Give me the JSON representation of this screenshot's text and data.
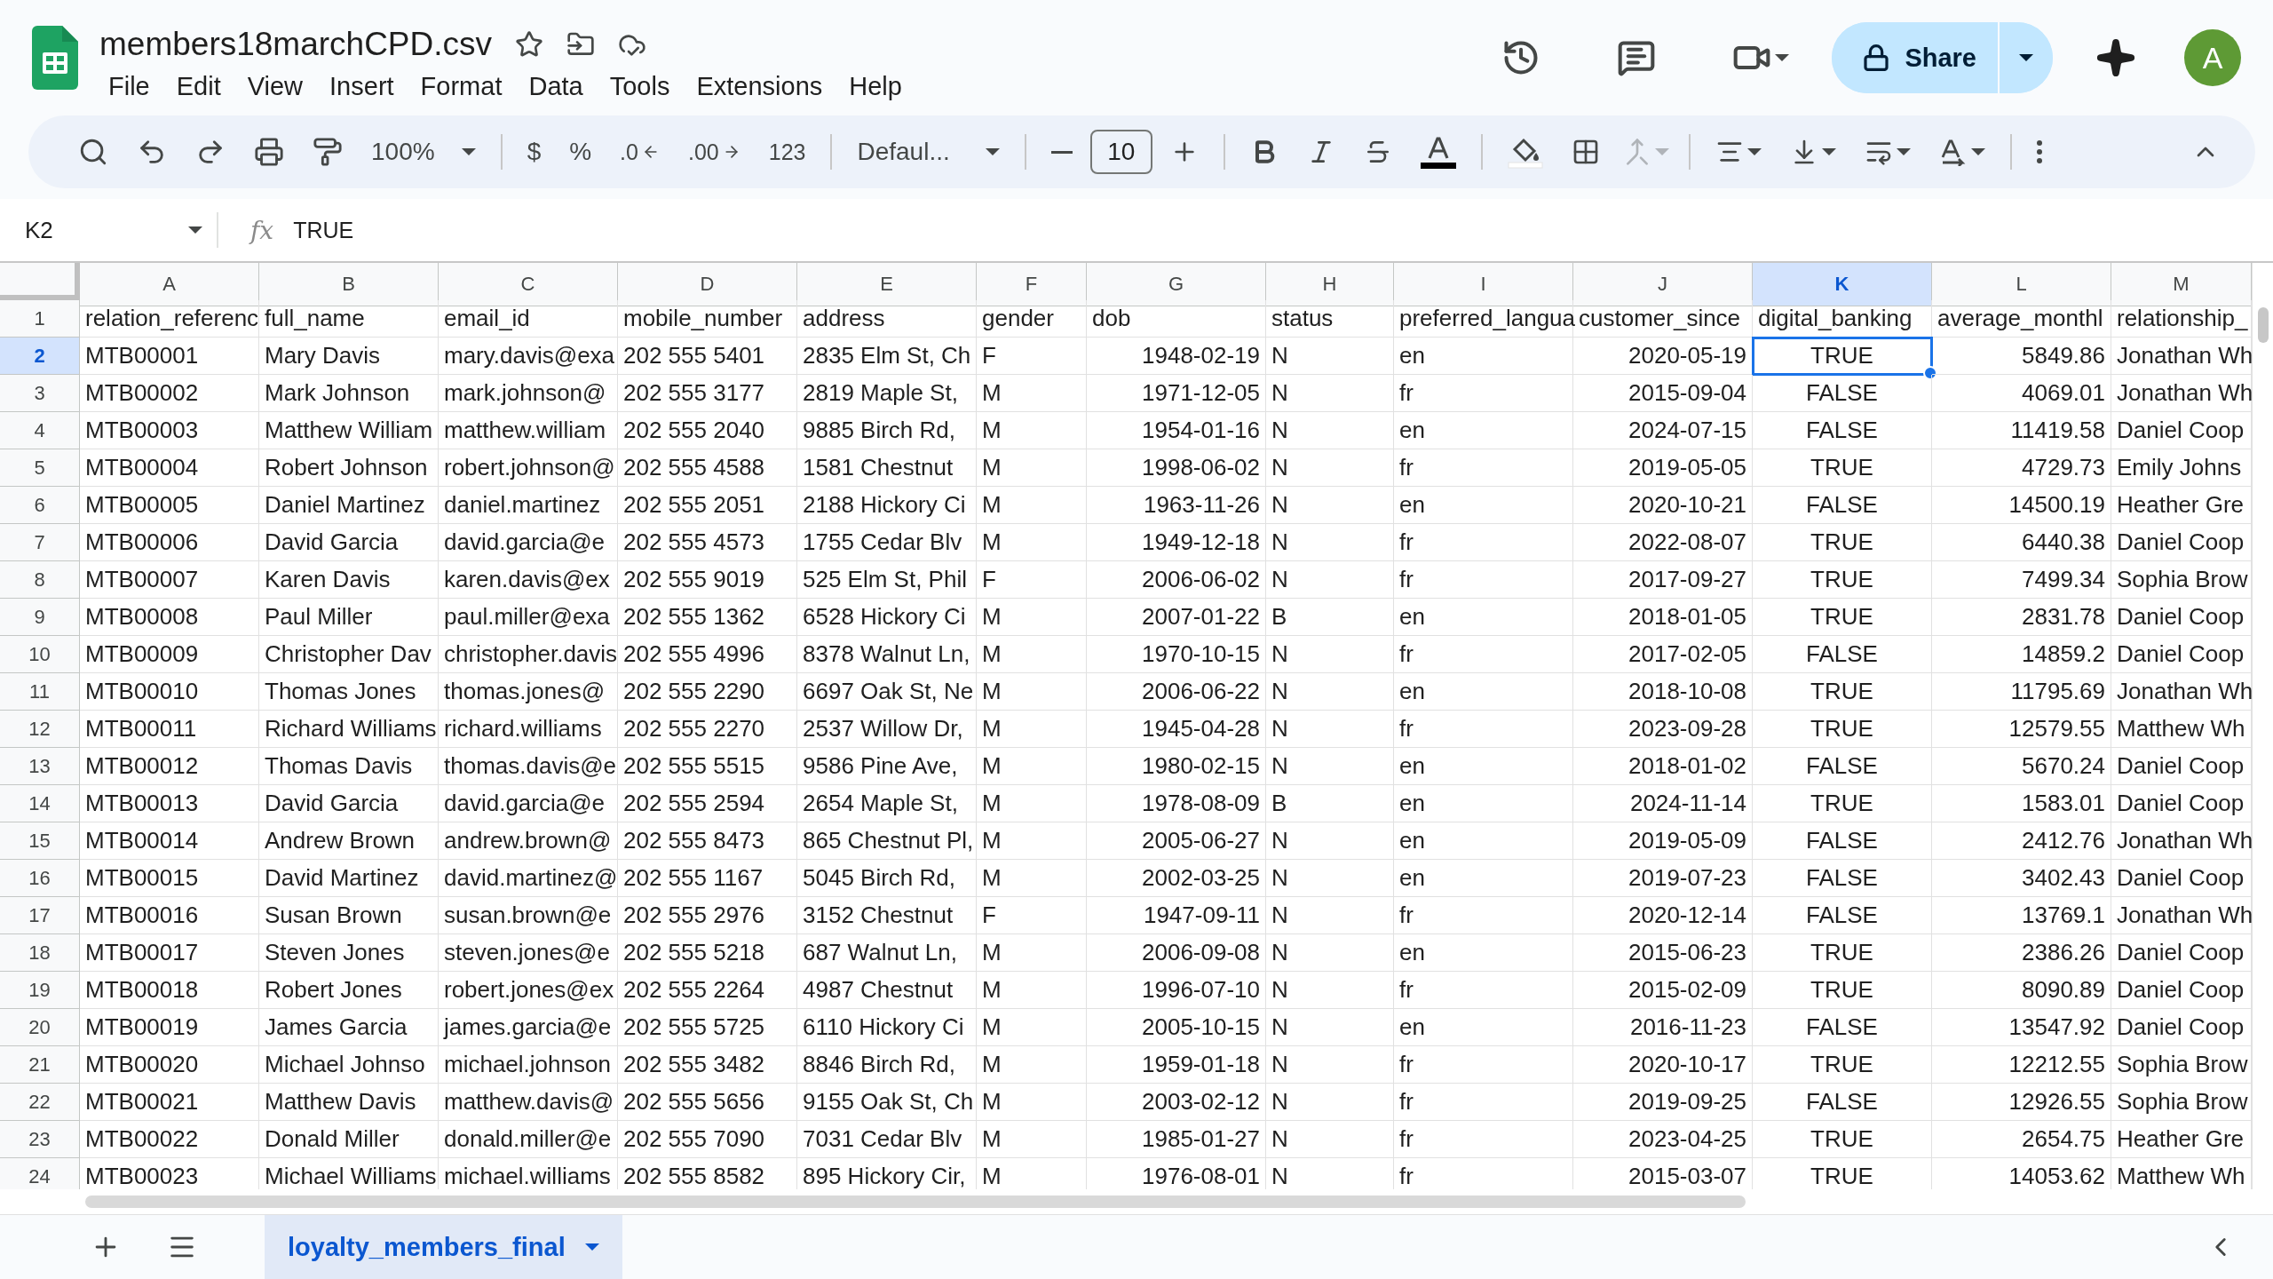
{
  "document": {
    "title": "members18marchCPD.csv"
  },
  "menu": [
    "File",
    "Edit",
    "View",
    "Insert",
    "Format",
    "Data",
    "Tools",
    "Extensions",
    "Help"
  ],
  "share": {
    "label": "Share"
  },
  "account": {
    "initial": "A"
  },
  "toolbar": {
    "zoom": "100%",
    "currency": "$",
    "percent": "%",
    "decimal_decrease": ".0",
    "decimal_increase": ".00",
    "number_format": "123",
    "font": "Defaul...",
    "font_size": "10"
  },
  "formula_bar": {
    "cell": "K2",
    "fx": "fx",
    "value": "TRUE"
  },
  "columns": [
    {
      "letter": "A",
      "kind": "text",
      "selected": false
    },
    {
      "letter": "B",
      "kind": "text",
      "selected": false
    },
    {
      "letter": "C",
      "kind": "text",
      "selected": false
    },
    {
      "letter": "D",
      "kind": "text",
      "selected": false
    },
    {
      "letter": "E",
      "kind": "text",
      "selected": false
    },
    {
      "letter": "F",
      "kind": "text",
      "selected": false
    },
    {
      "letter": "G",
      "kind": "number",
      "selected": false
    },
    {
      "letter": "H",
      "kind": "text",
      "selected": false
    },
    {
      "letter": "I",
      "kind": "text",
      "selected": false
    },
    {
      "letter": "J",
      "kind": "number",
      "selected": false
    },
    {
      "letter": "K",
      "kind": "bool",
      "selected": true
    },
    {
      "letter": "L",
      "kind": "number",
      "selected": false
    },
    {
      "letter": "M",
      "kind": "text",
      "selected": false
    }
  ],
  "rows": [
    {
      "number": "1",
      "kind": "header",
      "selected": false,
      "cells": [
        "relation_referenc",
        "full_name",
        "email_id",
        "mobile_number",
        "address",
        "gender",
        "dob",
        "status",
        "preferred_langua",
        "customer_since",
        "digital_banking",
        "average_monthl",
        "relationship_"
      ]
    },
    {
      "number": "2",
      "kind": "data",
      "selected": true,
      "cells": [
        "MTB00001",
        "Mary Davis",
        "mary.davis@exa",
        "202 555 5401",
        "2835 Elm St, Ch",
        "F",
        "1948-02-19",
        "N",
        "en",
        "2020-05-19",
        "TRUE",
        "5849.86",
        "Jonathan Wh"
      ]
    },
    {
      "number": "3",
      "kind": "data",
      "selected": false,
      "cells": [
        "MTB00002",
        "Mark Johnson",
        "mark.johnson@",
        "202 555 3177",
        "2819 Maple St,",
        "M",
        "1971-12-05",
        "N",
        "fr",
        "2015-09-04",
        "FALSE",
        "4069.01",
        "Jonathan Wh"
      ]
    },
    {
      "number": "4",
      "kind": "data",
      "selected": false,
      "cells": [
        "MTB00003",
        "Matthew William",
        "matthew.william",
        "202 555 2040",
        "9885 Birch Rd,",
        "M",
        "1954-01-16",
        "N",
        "en",
        "2024-07-15",
        "FALSE",
        "11419.58",
        "Daniel Coop"
      ]
    },
    {
      "number": "5",
      "kind": "data",
      "selected": false,
      "cells": [
        "MTB00004",
        "Robert Johnson",
        "robert.johnson@",
        "202 555 4588",
        "1581 Chestnut",
        "M",
        "1998-06-02",
        "N",
        "fr",
        "2019-05-05",
        "TRUE",
        "4729.73",
        "Emily Johns"
      ]
    },
    {
      "number": "6",
      "kind": "data",
      "selected": false,
      "cells": [
        "MTB00005",
        "Daniel Martinez",
        "daniel.martinez",
        "202 555 2051",
        "2188 Hickory Ci",
        "M",
        "1963-11-26",
        "N",
        "en",
        "2020-10-21",
        "FALSE",
        "14500.19",
        "Heather Gre"
      ]
    },
    {
      "number": "7",
      "kind": "data",
      "selected": false,
      "cells": [
        "MTB00006",
        "David Garcia",
        "david.garcia@e",
        "202 555 4573",
        "1755 Cedar Blv",
        "M",
        "1949-12-18",
        "N",
        "fr",
        "2022-08-07",
        "TRUE",
        "6440.38",
        "Daniel Coop"
      ]
    },
    {
      "number": "8",
      "kind": "data",
      "selected": false,
      "cells": [
        "MTB00007",
        "Karen Davis",
        "karen.davis@ex",
        "202 555 9019",
        "525 Elm St, Phil",
        "F",
        "2006-06-02",
        "N",
        "fr",
        "2017-09-27",
        "TRUE",
        "7499.34",
        "Sophia Brow"
      ]
    },
    {
      "number": "9",
      "kind": "data",
      "selected": false,
      "cells": [
        "MTB00008",
        "Paul Miller",
        "paul.miller@exa",
        "202 555 1362",
        "6528 Hickory Ci",
        "M",
        "2007-01-22",
        "B",
        "en",
        "2018-01-05",
        "TRUE",
        "2831.78",
        "Daniel Coop"
      ]
    },
    {
      "number": "10",
      "kind": "data",
      "selected": false,
      "cells": [
        "MTB00009",
        "Christopher Dav",
        "christopher.davis",
        "202 555 4996",
        "8378 Walnut Ln,",
        "M",
        "1970-10-15",
        "N",
        "fr",
        "2017-02-05",
        "FALSE",
        "14859.2",
        "Daniel Coop"
      ]
    },
    {
      "number": "11",
      "kind": "data",
      "selected": false,
      "cells": [
        "MTB00010",
        "Thomas Jones",
        "thomas.jones@",
        "202 555 2290",
        "6697 Oak St, Ne",
        "M",
        "2006-06-22",
        "N",
        "en",
        "2018-10-08",
        "TRUE",
        "11795.69",
        "Jonathan Wh"
      ]
    },
    {
      "number": "12",
      "kind": "data",
      "selected": false,
      "cells": [
        "MTB00011",
        "Richard Williams",
        "richard.williams",
        "202 555 2270",
        "2537 Willow Dr,",
        "M",
        "1945-04-28",
        "N",
        "fr",
        "2023-09-28",
        "TRUE",
        "12579.55",
        "Matthew Wh"
      ]
    },
    {
      "number": "13",
      "kind": "data",
      "selected": false,
      "cells": [
        "MTB00012",
        "Thomas Davis",
        "thomas.davis@e",
        "202 555 5515",
        "9586 Pine Ave,",
        "M",
        "1980-02-15",
        "N",
        "en",
        "2018-01-02",
        "FALSE",
        "5670.24",
        "Daniel Coop"
      ]
    },
    {
      "number": "14",
      "kind": "data",
      "selected": false,
      "cells": [
        "MTB00013",
        "David Garcia",
        "david.garcia@e",
        "202 555 2594",
        "2654 Maple St,",
        "M",
        "1978-08-09",
        "B",
        "en",
        "2024-11-14",
        "TRUE",
        "1583.01",
        "Daniel Coop"
      ]
    },
    {
      "number": "15",
      "kind": "data",
      "selected": false,
      "cells": [
        "MTB00014",
        "Andrew Brown",
        "andrew.brown@",
        "202 555 8473",
        "865 Chestnut Pl,",
        "M",
        "2005-06-27",
        "N",
        "en",
        "2019-05-09",
        "FALSE",
        "2412.76",
        "Jonathan Wh"
      ]
    },
    {
      "number": "16",
      "kind": "data",
      "selected": false,
      "cells": [
        "MTB00015",
        "David Martinez",
        "david.martinez@",
        "202 555 1167",
        "5045 Birch Rd,",
        "M",
        "2002-03-25",
        "N",
        "en",
        "2019-07-23",
        "FALSE",
        "3402.43",
        "Daniel Coop"
      ]
    },
    {
      "number": "17",
      "kind": "data",
      "selected": false,
      "cells": [
        "MTB00016",
        "Susan Brown",
        "susan.brown@e",
        "202 555 2976",
        "3152 Chestnut",
        "F",
        "1947-09-11",
        "N",
        "fr",
        "2020-12-14",
        "FALSE",
        "13769.1",
        "Jonathan Wh"
      ]
    },
    {
      "number": "18",
      "kind": "data",
      "selected": false,
      "cells": [
        "MTB00017",
        "Steven Jones",
        "steven.jones@e",
        "202 555 5218",
        "687 Walnut Ln,",
        "M",
        "2006-09-08",
        "N",
        "en",
        "2015-06-23",
        "TRUE",
        "2386.26",
        "Daniel Coop"
      ]
    },
    {
      "number": "19",
      "kind": "data",
      "selected": false,
      "cells": [
        "MTB00018",
        "Robert Jones",
        "robert.jones@ex",
        "202 555 2264",
        "4987 Chestnut",
        "M",
        "1996-07-10",
        "N",
        "fr",
        "2015-02-09",
        "TRUE",
        "8090.89",
        "Daniel Coop"
      ]
    },
    {
      "number": "20",
      "kind": "data",
      "selected": false,
      "cells": [
        "MTB00019",
        "James Garcia",
        "james.garcia@e",
        "202 555 5725",
        "6110 Hickory Ci",
        "M",
        "2005-10-15",
        "N",
        "en",
        "2016-11-23",
        "FALSE",
        "13547.92",
        "Daniel Coop"
      ]
    },
    {
      "number": "21",
      "kind": "data",
      "selected": false,
      "cells": [
        "MTB00020",
        "Michael Johnso",
        "michael.johnson",
        "202 555 3482",
        "8846 Birch Rd,",
        "M",
        "1959-01-18",
        "N",
        "fr",
        "2020-10-17",
        "TRUE",
        "12212.55",
        "Sophia Brow"
      ]
    },
    {
      "number": "22",
      "kind": "data",
      "selected": false,
      "cells": [
        "MTB00021",
        "Matthew Davis",
        "matthew.davis@",
        "202 555 5656",
        "9155 Oak St, Ch",
        "M",
        "2003-02-12",
        "N",
        "fr",
        "2019-09-25",
        "FALSE",
        "12926.55",
        "Sophia Brow"
      ]
    },
    {
      "number": "23",
      "kind": "data",
      "selected": false,
      "cells": [
        "MTB00022",
        "Donald Miller",
        "donald.miller@e",
        "202 555 7090",
        "7031 Cedar Blv",
        "M",
        "1985-01-27",
        "N",
        "fr",
        "2023-04-25",
        "TRUE",
        "2654.75",
        "Heather Gre"
      ]
    },
    {
      "number": "24",
      "kind": "data",
      "selected": false,
      "cells": [
        "MTB00023",
        "Michael Williams",
        "michael.williams",
        "202 555 8582",
        "895 Hickory Cir,",
        "M",
        "1976-08-01",
        "N",
        "fr",
        "2015-03-07",
        "TRUE",
        "14053.62",
        "Matthew Wh"
      ]
    }
  ],
  "sheets": [
    {
      "name": "loyalty_members_final",
      "selected": true
    }
  ]
}
